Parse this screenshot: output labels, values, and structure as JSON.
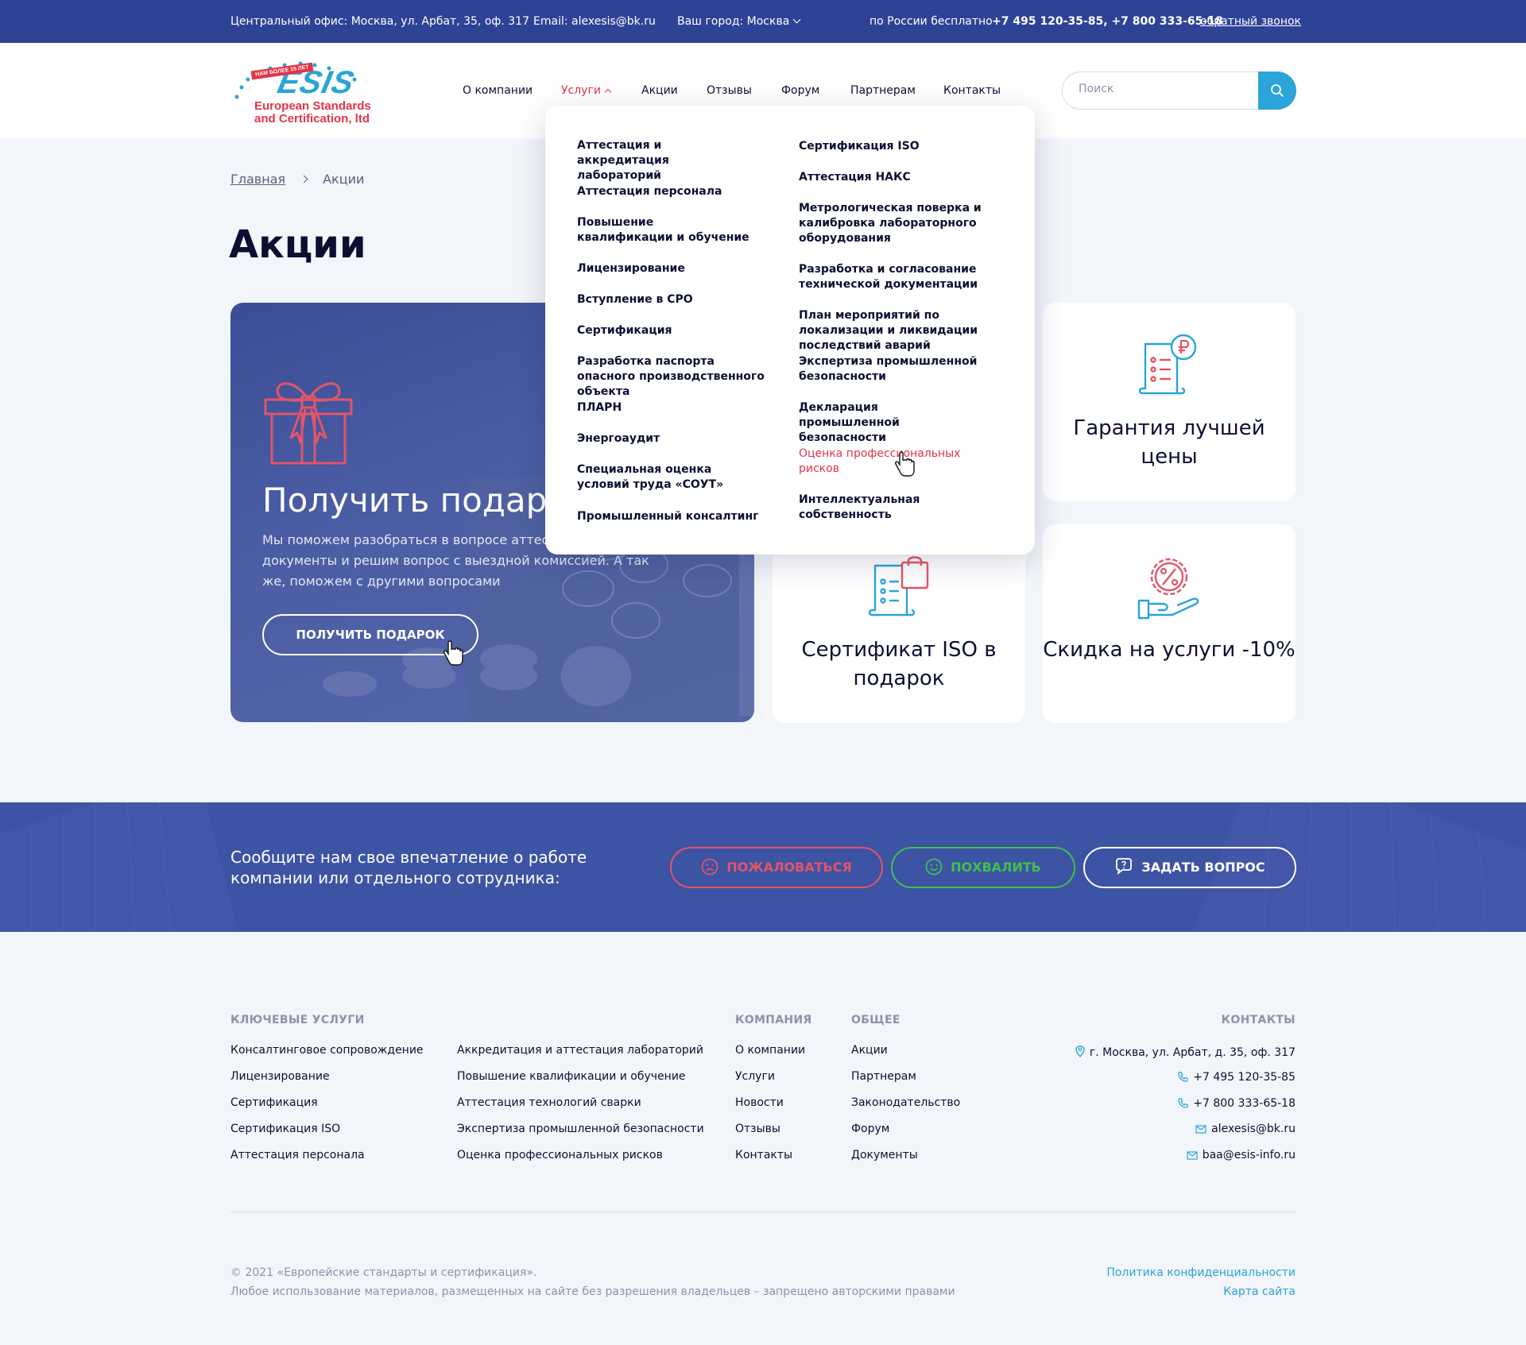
{
  "topbar": {
    "office": "Центральный офис: Москва, ул. Арбат, 35, оф. 317",
    "email": "Email: alexesis@bk.ru",
    "city": "Ваш город: Москва",
    "free_label": "по России бесплатно",
    "phones": "+7 495 120-35-85, +7 800 333-65-18",
    "callback": "обратный звонок"
  },
  "logo": {
    "ribbon": "НАМ БОЛЕЕ 15 ЛЕТ",
    "mark": "ESIS",
    "line1": "European Standards",
    "line2": "and Certification, ltd"
  },
  "nav": {
    "items": [
      "О компании",
      "Услуги",
      "Акции",
      "Отзывы",
      "Форум",
      "Партнерам",
      "Контакты"
    ]
  },
  "search": {
    "placeholder": "Поиск"
  },
  "breadcrumb": {
    "home": "Главная",
    "current": "Акции"
  },
  "page_title": "Акции",
  "promo": {
    "title": "Получить подарок",
    "text": "Мы поможем разобраться в вопросе аттестации, обсудим документы и решим вопрос с выездной комиссией. А так же, поможем с другими вопросами",
    "button": "ПОЛУЧИТЬ ПОДАРОК"
  },
  "features": {
    "price": "Гарантия лучшей цены",
    "iso": "Сертификат ISO в подарок",
    "discount": "Скидка на услуги -10%"
  },
  "dropdown": {
    "col1": [
      "Аттестация и аккредитация лабораторий",
      "Аттестация персонала",
      "Повышение квалификации и обучение",
      "Лицензирование",
      "Вступление в СРО",
      "Сертификация",
      "Разработка паспорта опасного производственного объекта",
      "ПЛАРН",
      "Энергоаудит",
      "Специальная оценка условий труда «СОУТ»",
      "Промышленный консалтинг"
    ],
    "col2": [
      "Сертификация ISO",
      "Аттестация НАКС",
      "Метрологическая поверка и калибровка лабораторного оборудования",
      "Разработка и согласование технической документации",
      "План мероприятий по локализации и ликвидации последствий аварий",
      "Экспертиза промышленной безопасности",
      "Декларация промышленной безопасности",
      "Оценка профессиональных рисков",
      "Интеллектуальная собственность"
    ]
  },
  "feedback": {
    "text": "Сообщите нам свое впечатление о работе компании или отдельного сотрудника:",
    "complain": "ПОЖАЛОВАТЬСЯ",
    "praise": "ПОХВАЛИТЬ",
    "ask": "ЗАДАТЬ ВОПРОС"
  },
  "footer": {
    "key_services_title": "КЛЮЧЕВЫЕ УСЛУГИ",
    "key_services_col1": [
      "Консалтинговое сопровождение",
      "Лицензирование",
      "Сертификация",
      "Сертификация ISO",
      "Аттестация персонала"
    ],
    "key_services_col2": [
      "Аккредитация и аттестация лабораторий",
      "Повышение квалификации и обучение",
      "Аттестация технологий сварки",
      "Экспертиза промышленной безопасности",
      "Оценка профессиональных рисков"
    ],
    "company_title": "КОМПАНИЯ",
    "company": [
      "О компании",
      "Услуги",
      "Новости",
      "Отзывы",
      "Контакты"
    ],
    "general_title": "ОБЩЕЕ",
    "general": [
      "Акции",
      "Партнерам",
      "Законодательство",
      "Форум",
      "Документы"
    ],
    "contacts_title": "КОНТАКТЫ",
    "address": "г. Москва, ул. Арбат, д. 35, оф. 317",
    "phone1": "+7 495 120-35-85",
    "phone2": "+7 800 333-65-18",
    "email1": "alexesis@bk.ru",
    "email2": "baa@esis-info.ru",
    "copyright": "© 2021 «Европейские стандарты и сертификация».",
    "notice": "Любое использование материалов, размещенных на сайте без разрешения владельцев – запрещено авторскими правами",
    "privacy": "Политика конфиденциальности",
    "sitemap": "Карта сайта"
  },
  "colors": {
    "primary": "#2f4396",
    "accent": "#2aa4d9",
    "red": "#e33447",
    "green": "#3ec14c",
    "text": "#0b1033"
  }
}
